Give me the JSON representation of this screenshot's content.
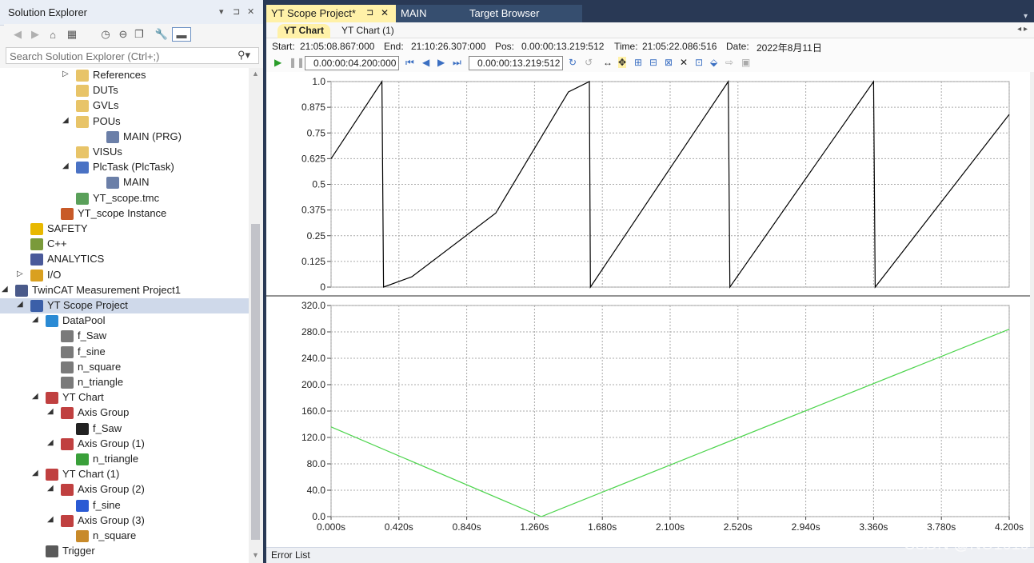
{
  "solution_explorer": {
    "title": "Solution Explorer",
    "title_buttons": [
      "▾",
      "⊐",
      "✕"
    ],
    "search_placeholder": "Search Solution Explorer (Ctrl+;)",
    "tree": [
      {
        "label": "References",
        "indent": 5,
        "arrow": "▷",
        "icon": "folder"
      },
      {
        "label": "DUTs",
        "indent": 5,
        "arrow": "",
        "icon": "folder"
      },
      {
        "label": "GVLs",
        "indent": 5,
        "arrow": "",
        "icon": "folder"
      },
      {
        "label": "POUs",
        "indent": 5,
        "arrow": "◢",
        "icon": "folder"
      },
      {
        "label": "MAIN (PRG)",
        "indent": 7,
        "arrow": "",
        "icon": "prg"
      },
      {
        "label": "VISUs",
        "indent": 5,
        "arrow": "",
        "icon": "folder"
      },
      {
        "label": "PlcTask (PlcTask)",
        "indent": 5,
        "arrow": "◢",
        "icon": "task"
      },
      {
        "label": "MAIN",
        "indent": 7,
        "arrow": "",
        "icon": "prg"
      },
      {
        "label": "YT_scope.tmc",
        "indent": 5,
        "arrow": "",
        "icon": "tmc"
      },
      {
        "label": "YT_scope Instance",
        "indent": 4,
        "arrow": "",
        "icon": "inst"
      },
      {
        "label": "SAFETY",
        "indent": 2,
        "arrow": "",
        "icon": "safety"
      },
      {
        "label": "C++",
        "indent": 2,
        "arrow": "",
        "icon": "cpp"
      },
      {
        "label": "ANALYTICS",
        "indent": 2,
        "arrow": "",
        "icon": "analytics"
      },
      {
        "label": "I/O",
        "indent": 2,
        "arrow": "▷",
        "icon": "io"
      },
      {
        "label": "TwinCAT Measurement Project1",
        "indent": 1,
        "arrow": "◢",
        "icon": "meas"
      },
      {
        "label": "YT Scope Project",
        "indent": 2,
        "arrow": "◢",
        "icon": "scope",
        "selected": true
      },
      {
        "label": "DataPool",
        "indent": 3,
        "arrow": "◢",
        "icon": "datapool"
      },
      {
        "label": "f_Saw",
        "indent": 4,
        "arrow": "",
        "icon": "f64"
      },
      {
        "label": "f_sine",
        "indent": 4,
        "arrow": "",
        "icon": "f64"
      },
      {
        "label": "n_square",
        "indent": 4,
        "arrow": "",
        "icon": "i16"
      },
      {
        "label": "n_triangle",
        "indent": 4,
        "arrow": "",
        "icon": "i16"
      },
      {
        "label": "YT Chart",
        "indent": 3,
        "arrow": "◢",
        "icon": "chart"
      },
      {
        "label": "Axis Group",
        "indent": 4,
        "arrow": "◢",
        "icon": "axis"
      },
      {
        "label": "f_Saw",
        "indent": 5,
        "arrow": "",
        "icon": "ch-saw"
      },
      {
        "label": "Axis Group (1)",
        "indent": 4,
        "arrow": "◢",
        "icon": "axis"
      },
      {
        "label": "n_triangle",
        "indent": 5,
        "arrow": "",
        "icon": "ch-tri"
      },
      {
        "label": "YT Chart (1)",
        "indent": 3,
        "arrow": "◢",
        "icon": "chart"
      },
      {
        "label": "Axis Group (2)",
        "indent": 4,
        "arrow": "◢",
        "icon": "axis"
      },
      {
        "label": "f_sine",
        "indent": 5,
        "arrow": "",
        "icon": "ch-sine"
      },
      {
        "label": "Axis Group (3)",
        "indent": 4,
        "arrow": "◢",
        "icon": "axis"
      },
      {
        "label": "n_square",
        "indent": 5,
        "arrow": "",
        "icon": "ch-sq"
      },
      {
        "label": "Trigger",
        "indent": 3,
        "arrow": "",
        "icon": "trigger"
      }
    ]
  },
  "editor": {
    "tabs": [
      {
        "label": "YT Scope Project*",
        "active": true,
        "pin": "⊐",
        "close": "✕"
      },
      {
        "label": "MAIN",
        "active": false
      },
      {
        "label": "Target Browser",
        "active": false
      }
    ],
    "subtabs": [
      "YT Chart",
      "YT Chart (1)"
    ],
    "info": {
      "start_label": "Start:",
      "start": "21:05:08.867:000",
      "end_label": "End:",
      "end": "21:10:26.307:000",
      "pos_label": "Pos:",
      "pos": "0.00:00:13.219:512",
      "time_label": "Time:",
      "time": "21:05:22.086:516",
      "date_label": "Date:",
      "date": "2022年8月11日"
    },
    "controls": {
      "span": "0.00:00:04.200:000",
      "position": "0.00:00:13.219:512"
    }
  },
  "chart_data": [
    {
      "type": "line",
      "series": [
        {
          "values": [
            [
              0.0,
              0.625
            ],
            [
              0.315,
              1.0
            ],
            [
              0.325,
              0.0
            ],
            [
              0.5,
              0.05
            ],
            [
              1.02,
              0.36
            ],
            [
              1.47,
              0.95
            ],
            [
              1.6,
              1.0
            ],
            [
              1.606,
              0.0
            ],
            [
              2.46,
              1.0
            ],
            [
              2.47,
              0.0
            ],
            [
              3.36,
              1.0
            ],
            [
              3.37,
              0.0
            ],
            [
              4.2,
              0.84
            ]
          ],
          "color": "#000000"
        }
      ],
      "ylim": [
        0,
        1.0
      ],
      "yticks": [
        "1.0",
        "0.875",
        "0.75",
        "0.625",
        "0.5",
        "0.375",
        "0.25",
        "0.125",
        "0"
      ],
      "grid": true
    },
    {
      "type": "line",
      "series": [
        {
          "values": [
            [
              0.0,
              136
            ],
            [
              1.302,
              0.0
            ],
            [
              4.2,
              284
            ]
          ],
          "color": "#4cd44c"
        }
      ],
      "ylim": [
        0,
        320
      ],
      "yticks": [
        "320.0",
        "280.0",
        "240.0",
        "200.0",
        "160.0",
        "120.0",
        "80.0",
        "40.0",
        "0.0"
      ],
      "xticks": [
        "0.000s",
        "0.420s",
        "0.840s",
        "1.260s",
        "1.680s",
        "2.100s",
        "2.520s",
        "2.940s",
        "3.360s",
        "3.780s",
        "4.200s"
      ],
      "xlim": [
        0,
        4.2
      ],
      "grid": true
    }
  ],
  "watermark": "CSDN @NO1019",
  "bottom_panel_label": "Error List"
}
